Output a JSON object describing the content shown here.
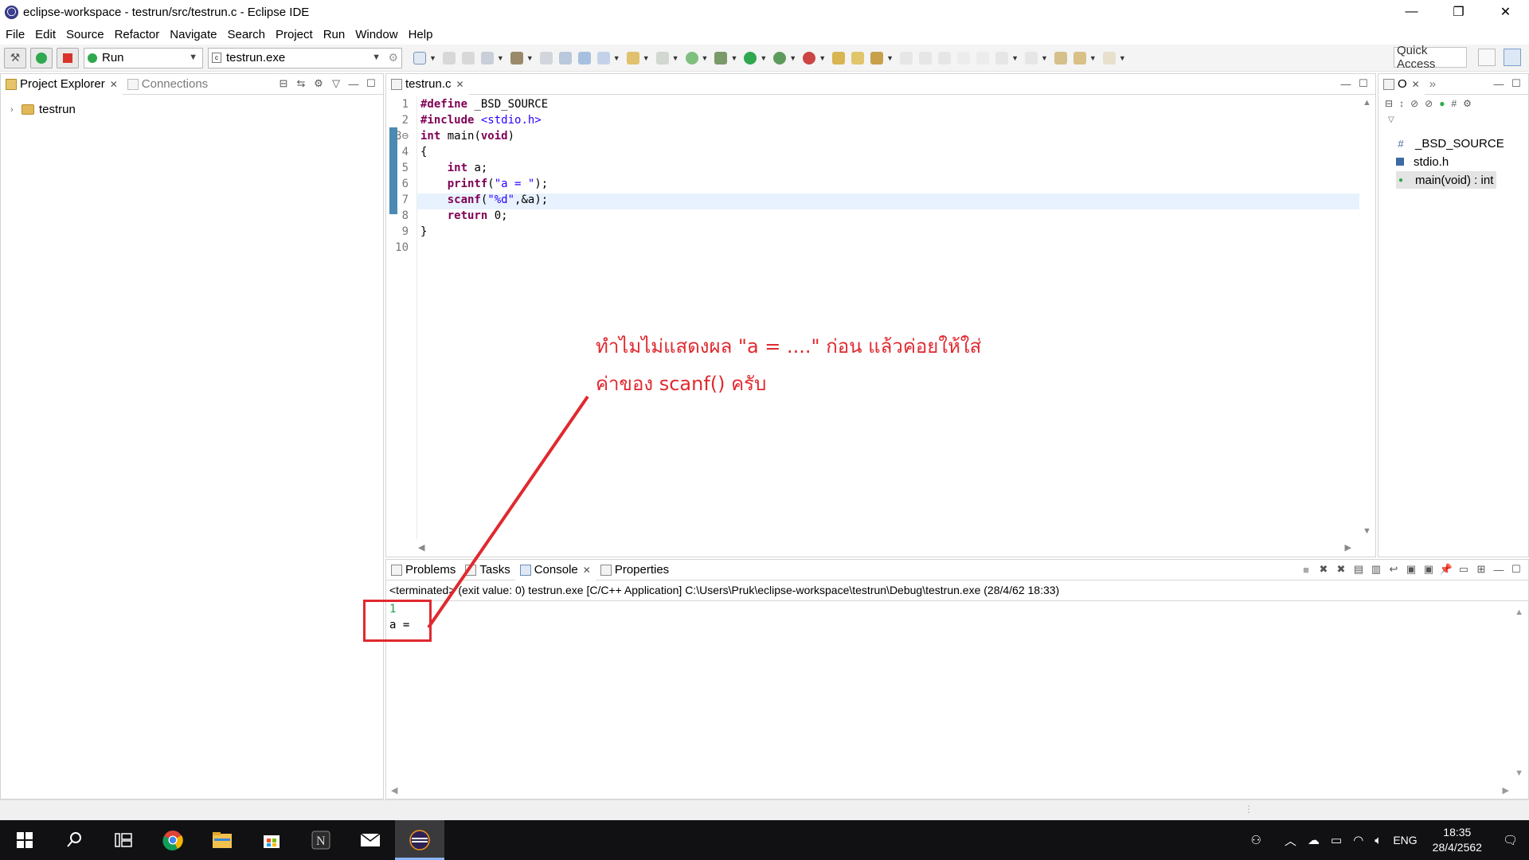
{
  "window": {
    "title": "eclipse-workspace - testrun/src/testrun.c - Eclipse IDE",
    "minimize": "—",
    "maximize": "❐",
    "close": "✕"
  },
  "menu": [
    "File",
    "Edit",
    "Source",
    "Refactor",
    "Navigate",
    "Search",
    "Project",
    "Run",
    "Window",
    "Help"
  ],
  "toolbar": {
    "launch_mode": "Run",
    "launch_config": "testrun.exe",
    "quick_access_placeholder": "Quick Access"
  },
  "project_explorer": {
    "tabs": [
      {
        "label": "Project Explorer",
        "active": true
      },
      {
        "label": "Connections",
        "active": false
      }
    ],
    "items": [
      {
        "label": "testrun"
      }
    ]
  },
  "editor": {
    "tab": "testrun.c",
    "line_numbers": [
      "1",
      "2",
      "3⊖",
      "4",
      "5",
      "6",
      "7",
      "8",
      "9",
      "10"
    ],
    "lines": [
      {
        "parts": [
          {
            "t": "#define",
            "c": "kw"
          },
          {
            "t": " _BSD_SOURCE",
            "c": ""
          }
        ]
      },
      {
        "parts": [
          {
            "t": "#include",
            "c": "kw"
          },
          {
            "t": " <stdio.h>",
            "c": "inc"
          }
        ]
      },
      {
        "parts": [
          {
            "t": "int",
            "c": "kw"
          },
          {
            "t": " main(",
            "c": "b"
          },
          {
            "t": "void",
            "c": "kw"
          },
          {
            "t": ")",
            "c": "b"
          }
        ]
      },
      {
        "parts": [
          {
            "t": "{",
            "c": ""
          }
        ]
      },
      {
        "parts": [
          {
            "t": "    ",
            "c": ""
          },
          {
            "t": "int",
            "c": "kw"
          },
          {
            "t": " a;",
            "c": ""
          }
        ]
      },
      {
        "parts": [
          {
            "t": "    ",
            "c": ""
          },
          {
            "t": "printf",
            "c": "kw"
          },
          {
            "t": "(",
            "c": ""
          },
          {
            "t": "\"a = \"",
            "c": "str"
          },
          {
            "t": ");",
            "c": ""
          }
        ]
      },
      {
        "parts": [
          {
            "t": "    ",
            "c": ""
          },
          {
            "t": "scanf",
            "c": "kw"
          },
          {
            "t": "(",
            "c": ""
          },
          {
            "t": "\"%d\"",
            "c": "str"
          },
          {
            "t": ",&a);",
            "c": ""
          }
        ]
      },
      {
        "parts": [
          {
            "t": "    ",
            "c": ""
          },
          {
            "t": "return",
            "c": "kw"
          },
          {
            "t": " 0;",
            "c": ""
          }
        ]
      },
      {
        "parts": [
          {
            "t": "}",
            "c": ""
          }
        ]
      },
      {
        "parts": [
          {
            "t": "",
            "c": ""
          }
        ]
      }
    ],
    "highlighted_line": 7
  },
  "outline": {
    "tab": "O",
    "items": [
      {
        "icon": "#",
        "label": "_BSD_SOURCE"
      },
      {
        "icon": "h",
        "label": "stdio.h"
      },
      {
        "icon": "●",
        "label": "main(void) : int",
        "selected": true
      }
    ]
  },
  "bottom_panel": {
    "tabs": [
      {
        "label": "Problems",
        "active": false
      },
      {
        "label": "Tasks",
        "active": false
      },
      {
        "label": "Console",
        "active": true
      },
      {
        "label": "Properties",
        "active": false
      }
    ],
    "console_info": "<terminated> (exit value: 0) testrun.exe [C/C++ Application] C:\\Users\\Pruk\\eclipse-workspace\\testrun\\Debug\\testrun.exe (28/4/62 18:33)",
    "console_input": "1",
    "console_output": "a ="
  },
  "annotation": {
    "line1": "ทำไมไม่แสดงผล \"a = ....\" ก่อน แล้วค่อยให้ใส่",
    "line2": "ค่าของ scanf() ครับ",
    "color": "#e0292f"
  },
  "taskbar": {
    "language": "ENG",
    "time": "18:35",
    "date": "28/4/2562"
  }
}
